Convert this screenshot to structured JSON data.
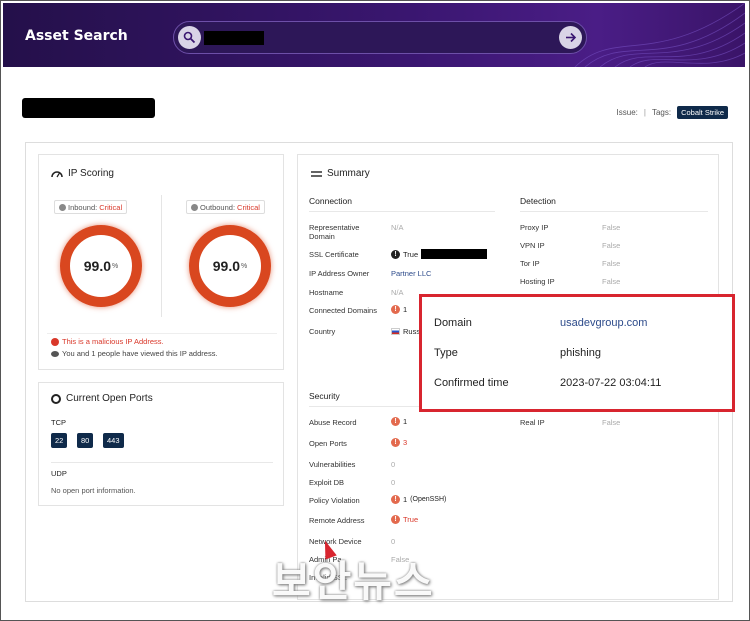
{
  "header": {
    "title": "Asset Search",
    "search_placeholder": ""
  },
  "issue_label": "Issue:",
  "tags_label": "Tags:",
  "tags": [
    "Cobalt Strike"
  ],
  "ip_scoring": {
    "title": "IP Scoring",
    "inbound_label": "Inbound:",
    "inbound_level": "Critical",
    "inbound_score": "99.0",
    "outbound_label": "Outbound:",
    "outbound_level": "Critical",
    "outbound_score": "99.0",
    "percent_unit": "%",
    "malicious_text": "This is a malicious IP Address.",
    "viewed_text": "You and 1 people have viewed this IP address."
  },
  "ports": {
    "title": "Current Open Ports",
    "tcp_label": "TCP",
    "tcp_ports": [
      "22",
      "80",
      "443"
    ],
    "udp_label": "UDP",
    "udp_empty": "No open port information."
  },
  "summary": {
    "title": "Summary",
    "connection": {
      "heading": "Connection",
      "rows": [
        {
          "label": "Representative Domain",
          "value": "N/A"
        },
        {
          "label": "SSL Certificate",
          "value": "True"
        },
        {
          "label": "IP Address Owner",
          "value": "Partner LLC"
        },
        {
          "label": "Hostname",
          "value": "N/A"
        },
        {
          "label": "Connected Domains",
          "value": "1"
        },
        {
          "label": "Country",
          "value": "Russ"
        }
      ]
    },
    "detection": {
      "heading": "Detection",
      "rows": [
        {
          "label": "Proxy IP",
          "value": "False"
        },
        {
          "label": "VPN IP",
          "value": "False"
        },
        {
          "label": "Tor IP",
          "value": "False"
        },
        {
          "label": "Hosting IP",
          "value": "False"
        },
        {
          "label": "Real IP",
          "value": "False"
        }
      ]
    },
    "security": {
      "heading": "Security",
      "rows": [
        {
          "label": "Abuse Record",
          "value": "1"
        },
        {
          "label": "Open Ports",
          "value": "3"
        },
        {
          "label": "Vulnerabilities",
          "value": "0"
        },
        {
          "label": "Exploit DB",
          "value": "0"
        },
        {
          "label": "Policy Violation",
          "value": "1",
          "note": "(OpenSSH)"
        },
        {
          "label": "Remote Address",
          "value": "True"
        },
        {
          "label": "Network Device",
          "value": "0"
        },
        {
          "label": "Admin Pa",
          "value": "False"
        },
        {
          "label": "Invalid SSL",
          "value": ""
        }
      ]
    }
  },
  "popup": {
    "domain_label": "Domain",
    "domain_value": "usadevgroup.com",
    "type_label": "Type",
    "type_value": "phishing",
    "time_label": "Confirmed time",
    "time_value": "2023-07-22 03:04:11"
  },
  "watermark": "보안뉴스",
  "colors": {
    "header": "#3a1670",
    "critical": "#d9471f",
    "tag": "#0f2a4a",
    "highlight": "#d8252f"
  }
}
